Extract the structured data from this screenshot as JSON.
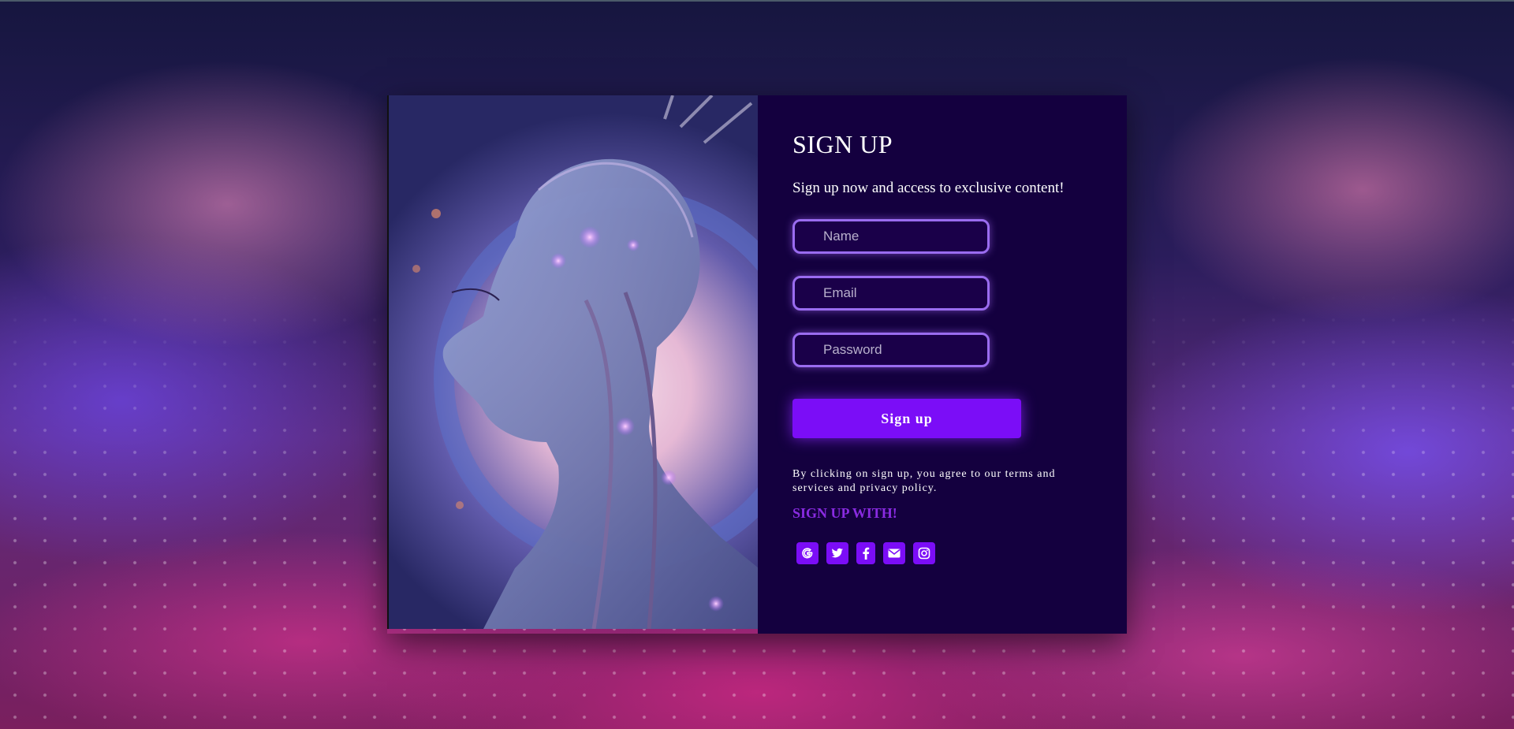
{
  "form": {
    "title": "SIGN UP",
    "subtitle": "Sign up now and access to exclusive content!",
    "name_placeholder": "Name",
    "email_placeholder": "Email",
    "password_placeholder": "Password",
    "submit_label": "Sign up",
    "terms_prefix": "By clicking on sign up, you agree to our ",
    "terms_link": "terms and services",
    "terms_middle": " and ",
    "privacy_link": "privacy policy",
    "terms_suffix": ".",
    "social_heading": "SIGN UP WITH!"
  },
  "social": [
    {
      "icon": "google-icon"
    },
    {
      "icon": "twitter-icon"
    },
    {
      "icon": "facebook-icon"
    },
    {
      "icon": "envelope-icon"
    },
    {
      "icon": "instagram-icon"
    }
  ],
  "colors": {
    "panel_bg": "#14003f",
    "accent": "#7b0df7",
    "field_border": "#9a6cf0",
    "heading_accent": "#8a2be2"
  }
}
